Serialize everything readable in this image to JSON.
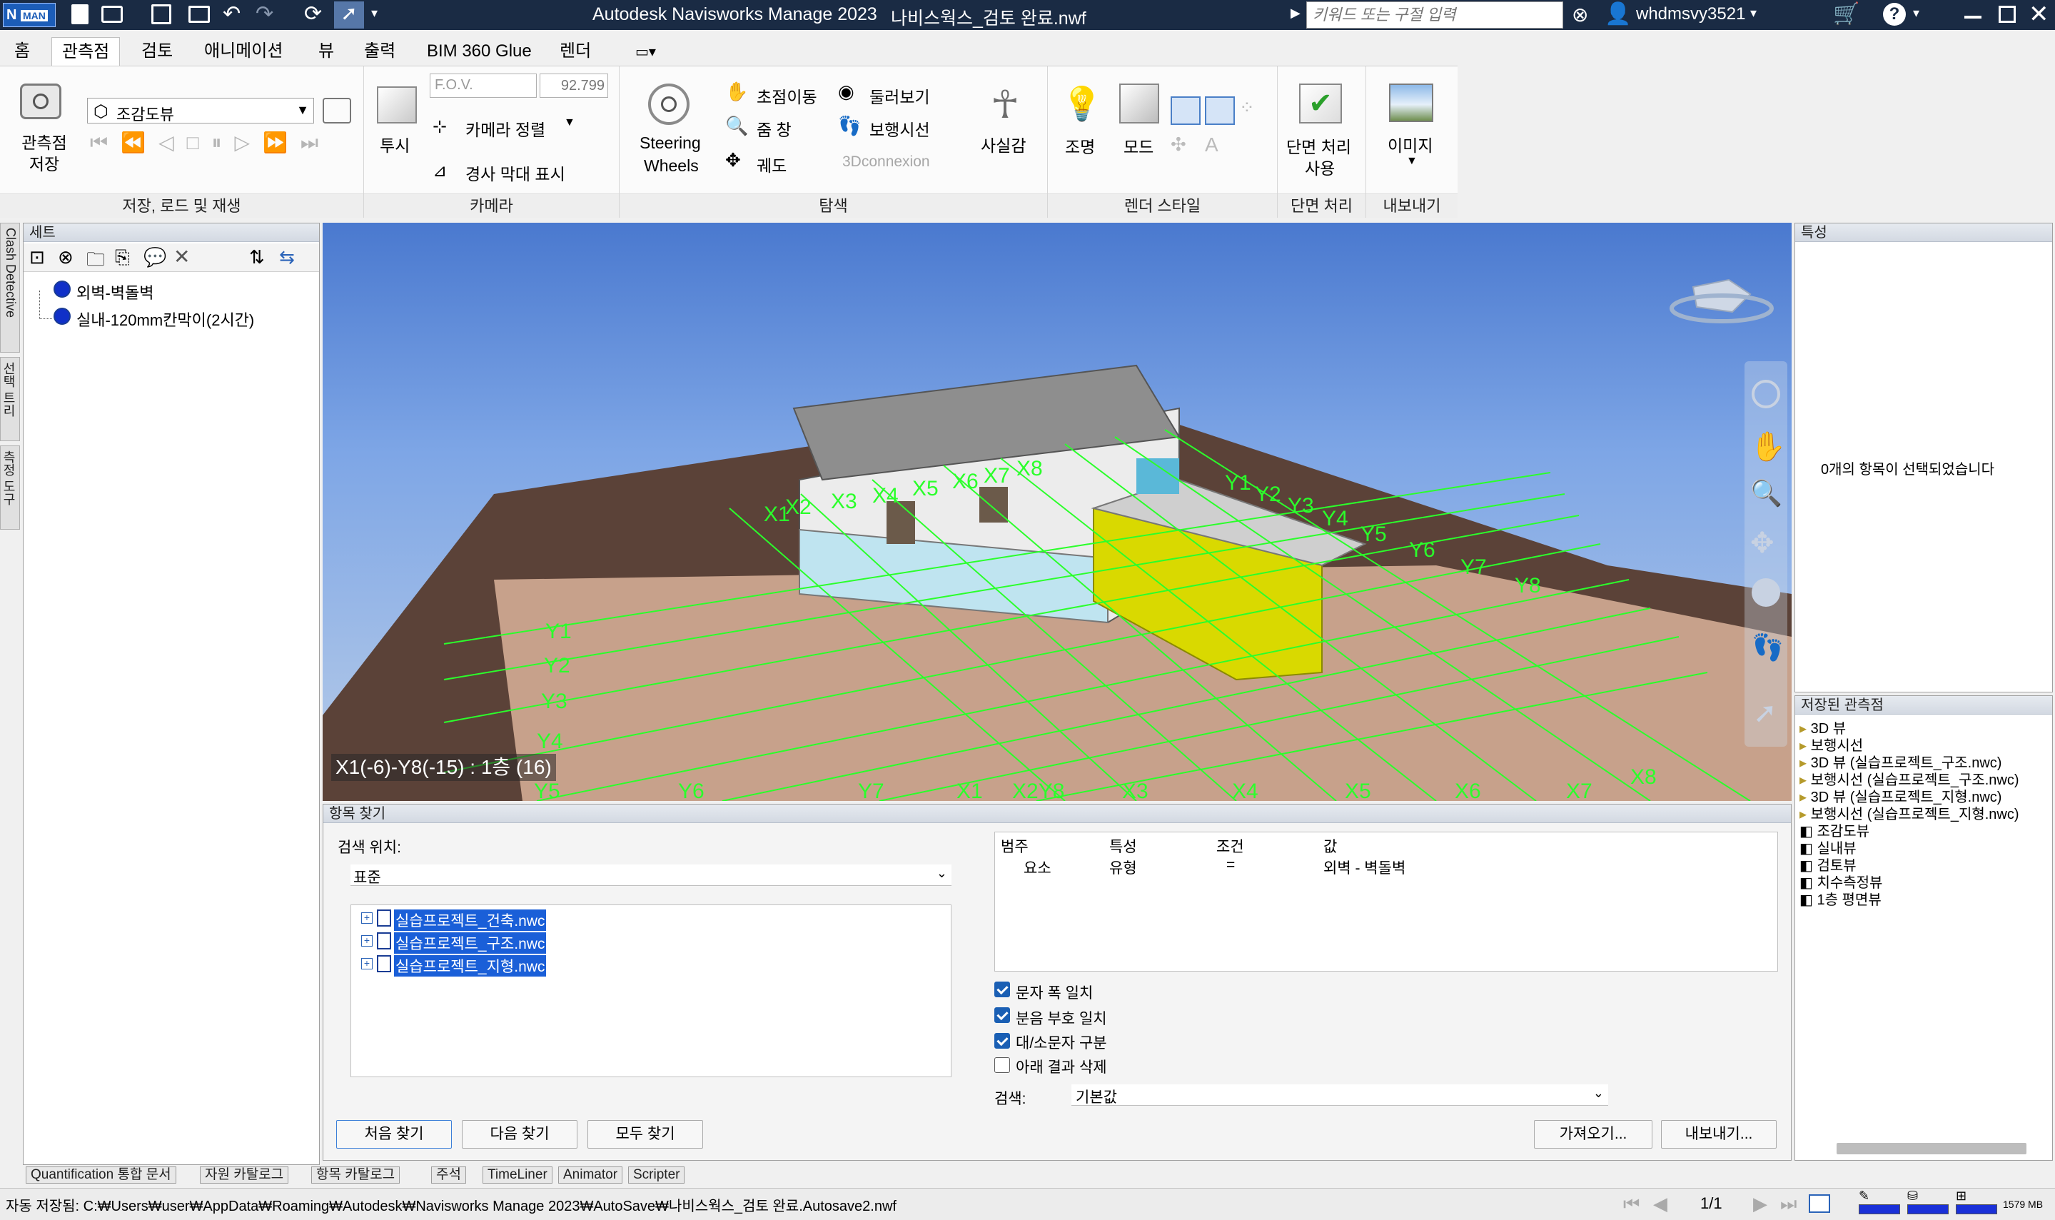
{
  "titlebar": {
    "app_title": "Autodesk Navisworks Manage 2023",
    "file_title": "나비스웍스_검토 완료.nwf",
    "search_placeholder": "키워드 또는 구절 입력",
    "username": "whdmsvy3521",
    "logo": "MAN"
  },
  "menu": [
    "홈",
    "관측점",
    "검토",
    "애니메이션",
    "뷰",
    "출력",
    "BIM 360 Glue",
    "렌더"
  ],
  "ribbon": {
    "save_viewpoint": "관측점\n저장",
    "viewpoint_select": "조감도뷰",
    "group_save": "저장, 로드 및 재생",
    "perspective": "투시",
    "fov_label": "F.O.V.",
    "fov_value": "92.799",
    "camera_align": "카메라 정렬",
    "show_tilt": "경사 막대 표시",
    "group_camera": "카메라",
    "steering1": "Steering",
    "steering2": "Wheels",
    "pan": "초점이동",
    "zoom": "줌 창",
    "orbit": "궤도",
    "look_around": "둘러보기",
    "walk": "보행시선",
    "connexion": "3Dconnexion",
    "realism": "사실감",
    "group_nav": "탐색",
    "lighting": "조명",
    "mode": "모드",
    "group_render": "렌더 스타일",
    "sectioning1": "단면 처리",
    "sectioning2": "사용",
    "group_section": "단면 처리",
    "image": "이미지",
    "group_export": "내보내기"
  },
  "sets_panel": {
    "title": "세트",
    "items": [
      "외벽-벽돌벽",
      "실내-120mm칸막이(2시간)"
    ]
  },
  "side_tabs": [
    "Clash Detective",
    "선택 트리",
    "측정 도구"
  ],
  "viewport": {
    "status": "X1(-6)-Y8(-15) : 1층 (16)",
    "grid_x": [
      "X1",
      "X2",
      "X3",
      "X4",
      "X5",
      "X6",
      "X7",
      "X8"
    ],
    "grid_y": [
      "Y1",
      "Y2",
      "Y3",
      "Y4",
      "Y5",
      "Y6",
      "Y7",
      "Y8"
    ],
    "bottom_labels": [
      "Y5",
      "Y6",
      "Y7",
      "X1",
      "X2Y8",
      "X3",
      "X4",
      "X5",
      "X6",
      "X7",
      "X8"
    ]
  },
  "find_items": {
    "title": "항목 찾기",
    "search_in_label": "검색 위치:",
    "search_in_value": "표준",
    "files": [
      "실습프로젝트_건축.nwc",
      "실습프로젝트_구조.nwc",
      "실습프로젝트_지형.nwc"
    ],
    "grid_headers": [
      "범주",
      "특성",
      "조건",
      "값"
    ],
    "grid_row": [
      "요소",
      "유형",
      "=",
      "외벽 - 벽돌벽"
    ],
    "options": [
      {
        "label": "문자 폭 일치",
        "checked": true
      },
      {
        "label": "분음 부호 일치",
        "checked": true
      },
      {
        "label": "대/소문자 구분",
        "checked": true
      },
      {
        "label": "아래 결과 삭제",
        "checked": false
      }
    ],
    "search_label": "검색:",
    "search_value": "기본값",
    "btn_find_first": "처음 찾기",
    "btn_find_next": "다음 찾기",
    "btn_find_all": "모두 찾기",
    "btn_import": "가져오기...",
    "btn_export": "내보내기..."
  },
  "properties": {
    "title": "특성",
    "empty_msg": "0개의 항목이 선택되었습니다"
  },
  "saved_viewpoints": {
    "title": "저장된 관측점",
    "items": [
      "3D 뷰",
      "보행시선",
      "3D 뷰 (실습프로젝트_구조.nwc)",
      "보행시선 (실습프로젝트_구조.nwc)",
      "3D 뷰 (실습프로젝트_지형.nwc)",
      "보행시선 (실습프로젝트_지형.nwc)",
      "조감도뷰",
      "실내뷰",
      "검토뷰",
      "치수측정뷰",
      "1층 평면뷰"
    ]
  },
  "bottom_tabs": [
    "Quantification 통합 문서",
    "자원 카탈로그",
    "항목 카탈로그",
    "주석",
    "TimeLiner",
    "Animator",
    "Scripter"
  ],
  "status_bar": {
    "autosave": "자동 저장됨: C:₩Users₩user₩AppData₩Roaming₩Autodesk₩Navisworks Manage 2023₩AutoSave₩나비스웍스_검토 완료.Autosave2.nwf",
    "page": "1/1",
    "memory": "1579 MB"
  },
  "colors": {
    "title_bg": "#1a2b44",
    "viewport_sky": "#5b8ad9",
    "ground": "#5b4238",
    "grid": "#2bff2b",
    "accent": "#1a5fb4"
  }
}
